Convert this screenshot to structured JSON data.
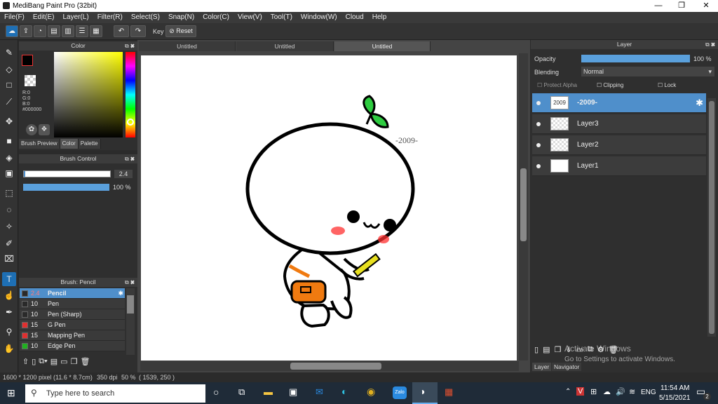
{
  "app": {
    "title": "MediBang Paint Pro (32bit)",
    "min": "—",
    "max": "❐",
    "close": "✕"
  },
  "menu": [
    "File(F)",
    "Edit(E)",
    "Layer(L)",
    "Filter(R)",
    "Select(S)",
    "Snap(N)",
    "Color(C)",
    "View(V)",
    "Tool(T)",
    "Window(W)",
    "Cloud",
    "Help"
  ],
  "toolbar": {
    "key_label": "Key",
    "reset_label": "Reset"
  },
  "color_panel": {
    "title": "Color",
    "r": "R:0",
    "g": "G:0",
    "b": "B:0",
    "hex": "#000000",
    "tabs": [
      "Brush Preview",
      "Color",
      "Palette"
    ]
  },
  "brush_control": {
    "title": "Brush Control",
    "size": "2.4",
    "opacity": "100 %"
  },
  "brush_panel": {
    "title": "Brush: Pencil",
    "items": [
      {
        "size": "2.4",
        "name": "Pencil",
        "color": "#2a2a2a"
      },
      {
        "size": "10",
        "name": "Pen",
        "color": "#2a2a2a"
      },
      {
        "size": "10",
        "name": "Pen (Sharp)",
        "color": "#2a2a2a"
      },
      {
        "size": "15",
        "name": "G Pen",
        "color": "#e03030"
      },
      {
        "size": "15",
        "name": "Mapping Pen",
        "color": "#e03030"
      },
      {
        "size": "10",
        "name": "Edge Pen",
        "color": "#20b020"
      }
    ]
  },
  "doc_tabs": [
    "Untitled",
    "Untitled",
    "Untitled"
  ],
  "canvas": {
    "text": "-2009-"
  },
  "layer_panel": {
    "title": "Layer",
    "opacity_label": "Opacity",
    "opacity_value": "100 %",
    "blending_label": "Blending",
    "blending_value": "Normal",
    "protect_alpha": "Protect Alpha",
    "clipping": "Clipping",
    "lock": "Lock",
    "layers": [
      {
        "name": "-2009-",
        "thumb": "2009"
      },
      {
        "name": "Layer3",
        "thumb": ""
      },
      {
        "name": "Layer2",
        "thumb": ""
      },
      {
        "name": "Layer1",
        "thumb": ""
      }
    ],
    "bottom_tabs": [
      "Layer",
      "Navigator"
    ],
    "watermark_1": "Activate Windows",
    "watermark_2": "Go to Settings to activate Windows."
  },
  "status": {
    "size": "1600 * 1200 pixel",
    "phys": "(11.6 * 8.7cm)",
    "dpi": "350 dpi",
    "zoom": "50 %",
    "coords": "( 1539, 250 )"
  },
  "taskbar": {
    "search_placeholder": "Type here to search",
    "lang": "ENG",
    "time": "11:54 AM",
    "date": "5/15/2021",
    "notif": "2"
  },
  "colors": {
    "accent": "#4f8fcb",
    "bg": "#2f2f2f",
    "sprout": "#2ecc40",
    "bag": "#f07a10",
    "blush": "#ff3030"
  }
}
